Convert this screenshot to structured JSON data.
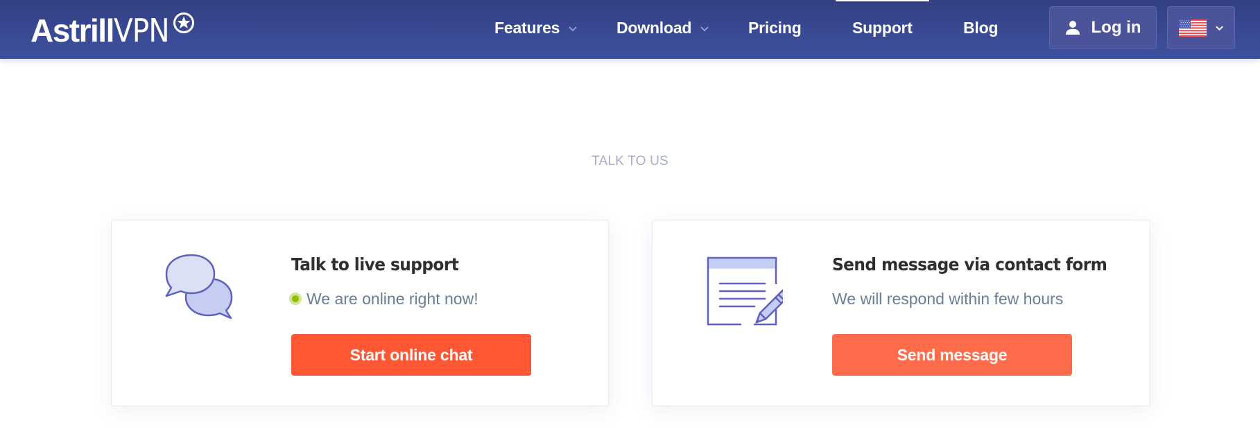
{
  "brand": {
    "name_bold": "Astrill",
    "name_light": "VPN",
    "logo_icon": "star-badge-icon"
  },
  "nav": {
    "items": [
      {
        "label": "Features",
        "has_dropdown": true,
        "active": false
      },
      {
        "label": "Download",
        "has_dropdown": true,
        "active": false
      },
      {
        "label": "Pricing",
        "has_dropdown": false,
        "active": false
      },
      {
        "label": "Support",
        "has_dropdown": false,
        "active": true
      },
      {
        "label": "Blog",
        "has_dropdown": false,
        "active": false
      }
    ],
    "login_label": "Log in",
    "login_icon": "user-icon",
    "language": {
      "selected": "English (US)",
      "icon": "us-flag-icon"
    }
  },
  "section": {
    "eyebrow": "TALK TO US",
    "cards": [
      {
        "icon": "chat-bubbles-icon",
        "title": "Talk to live support",
        "status": "We are online right now!",
        "status_indicator": "online",
        "button_label": "Start online chat"
      },
      {
        "icon": "contact-form-icon",
        "title": "Send message via contact form",
        "status": "We will respond within few hours",
        "button_label": "Send message"
      }
    ]
  },
  "colors": {
    "nav_bg": "#36468c",
    "accent_orange": "#ff5733",
    "accent_orange_light": "#ff6c4b",
    "online_green": "#8ec000",
    "icon_stroke": "#5f5fc4",
    "icon_fill": "#c5cdf2"
  }
}
